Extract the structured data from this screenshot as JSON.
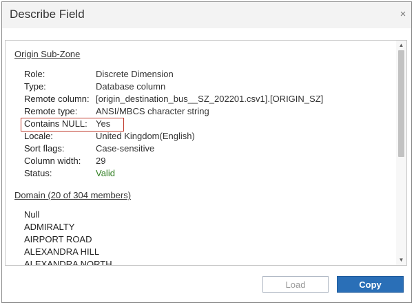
{
  "dialog": {
    "title": "Describe Field",
    "close_glyph": "×"
  },
  "field": {
    "name": "Origin Sub-Zone",
    "properties": [
      {
        "label": "Role:",
        "value": "Discrete Dimension"
      },
      {
        "label": "Type:",
        "value": "Database column"
      },
      {
        "label": "Remote column:",
        "value": "[origin_destination_bus__SZ_202201.csv1].[ORIGIN_SZ]"
      },
      {
        "label": "Remote type:",
        "value": "ANSI/MBCS character string"
      },
      {
        "label": "Contains NULL:",
        "value": "Yes"
      },
      {
        "label": "Locale:",
        "value": "United Kingdom(English)"
      },
      {
        "label": "Sort flags:",
        "value": "Case-sensitive"
      },
      {
        "label": "Column width:",
        "value": "29"
      },
      {
        "label": "Status:",
        "value": "Valid"
      }
    ]
  },
  "domain": {
    "header": "Domain (20 of 304 members)",
    "members": [
      "Null",
      "ADMIRALTY",
      "AIRPORT ROAD",
      "ALEXANDRA HILL",
      "ALEXANDRA NORTH"
    ]
  },
  "buttons": {
    "load": "Load",
    "copy": "Copy"
  },
  "colors": {
    "valid_status": "#2e7d1f",
    "highlight_border": "#c0392b",
    "primary_button": "#2a6fb7"
  }
}
